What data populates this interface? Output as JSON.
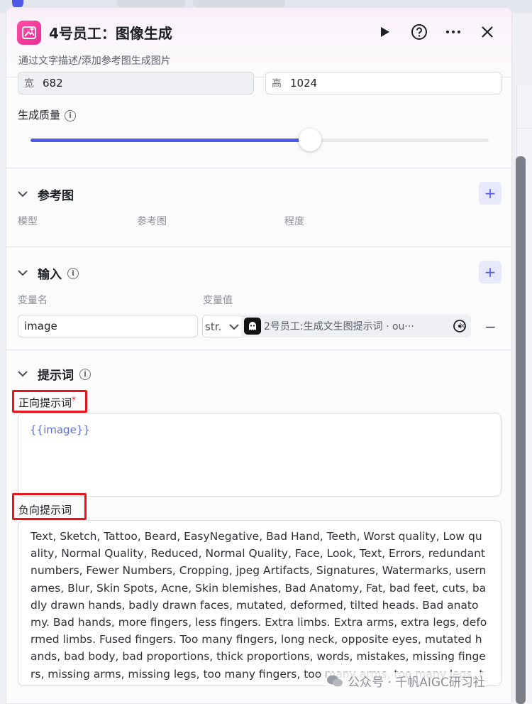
{
  "header": {
    "title": "4号员工：图像生成",
    "subtitle": "通过文字描述/添加参考图生成图片"
  },
  "size": {
    "width_prefix": "宽",
    "width_value": "682",
    "height_prefix": "高",
    "height_value": "1024"
  },
  "quality": {
    "label": "生成质量",
    "slider_fraction": 0.61
  },
  "reference": {
    "title": "参考图",
    "col_model": "模型",
    "col_ref": "参考图",
    "col_degree": "程度"
  },
  "input": {
    "title": "输入",
    "col_name": "变量名",
    "col_value": "变量值",
    "var_name": "image",
    "type_label": "str.",
    "ref_text": "2号员工:生成文生图提示词 · ou···"
  },
  "prompt": {
    "title": "提示词",
    "positive_label": "正向提示词",
    "required_mark": "*",
    "positive_value": "{{image}}",
    "negative_label": "负向提示词",
    "negative_value": "Text, Sketch, Tattoo, Beard, EasyNegative, Bad Hand, Teeth, Worst quality, Low quality, Normal Quality, Reduced, Normal Quality, Face, Look, Text, Errors, redundant numbers, Fewer Numbers, Cropping, jpeg Artifacts, Signatures, Watermarks, usernames, Blur, Skin Spots, Acne, Skin blemishes, Bad Anatomy, Fat, bad feet, cuts, badly drawn hands, badly drawn faces, mutated, deformed, tilted heads. Bad anatomy. Bad hands, more fingers, less fingers. Extra limbs. Extra arms, extra legs, deformed limbs. Fused fingers. Too many fingers, long neck, opposite eyes, mutated hands, bad body, bad proportions, thick proportions, words, mistakes, missing fingers, missing arms, missing legs, too many fingers, too many arms, too many legs, too many feet, too few fingers"
  },
  "watermark": {
    "text": "公众号 · 千帆AIGC研习社"
  },
  "colors": {
    "accent": "#4e5ae8",
    "highlight": "#e8141b",
    "brand_pink": "#e82e96"
  }
}
